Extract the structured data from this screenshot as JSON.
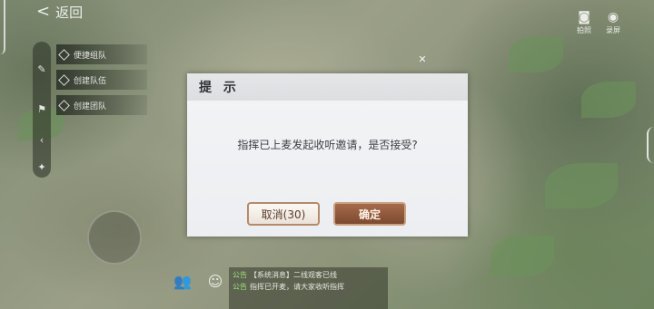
{
  "hud": {
    "back_label": "返回",
    "team_menu": [
      "便捷组队",
      "创建队伍",
      "创建团队"
    ],
    "right_top": [
      {
        "icon": "camera-icon",
        "label": "拍照"
      },
      {
        "icon": "record-icon",
        "label": "录屏"
      }
    ],
    "chat": [
      {
        "tag": "公告",
        "text": "【系统消息】二线观客已线"
      },
      {
        "tag": "公告",
        "text": "指挥已开麦，请大家收听指挥"
      }
    ]
  },
  "dialog": {
    "title": "提 示",
    "message": "指挥已上麦发起收听邀请，是否接受?",
    "cancel_label": "取消(30)",
    "confirm_label": "确定"
  },
  "colors": {
    "dialog_bg": "#eceef1",
    "confirm_bg": "#7d4a30",
    "cancel_border": "#b58a6a"
  }
}
